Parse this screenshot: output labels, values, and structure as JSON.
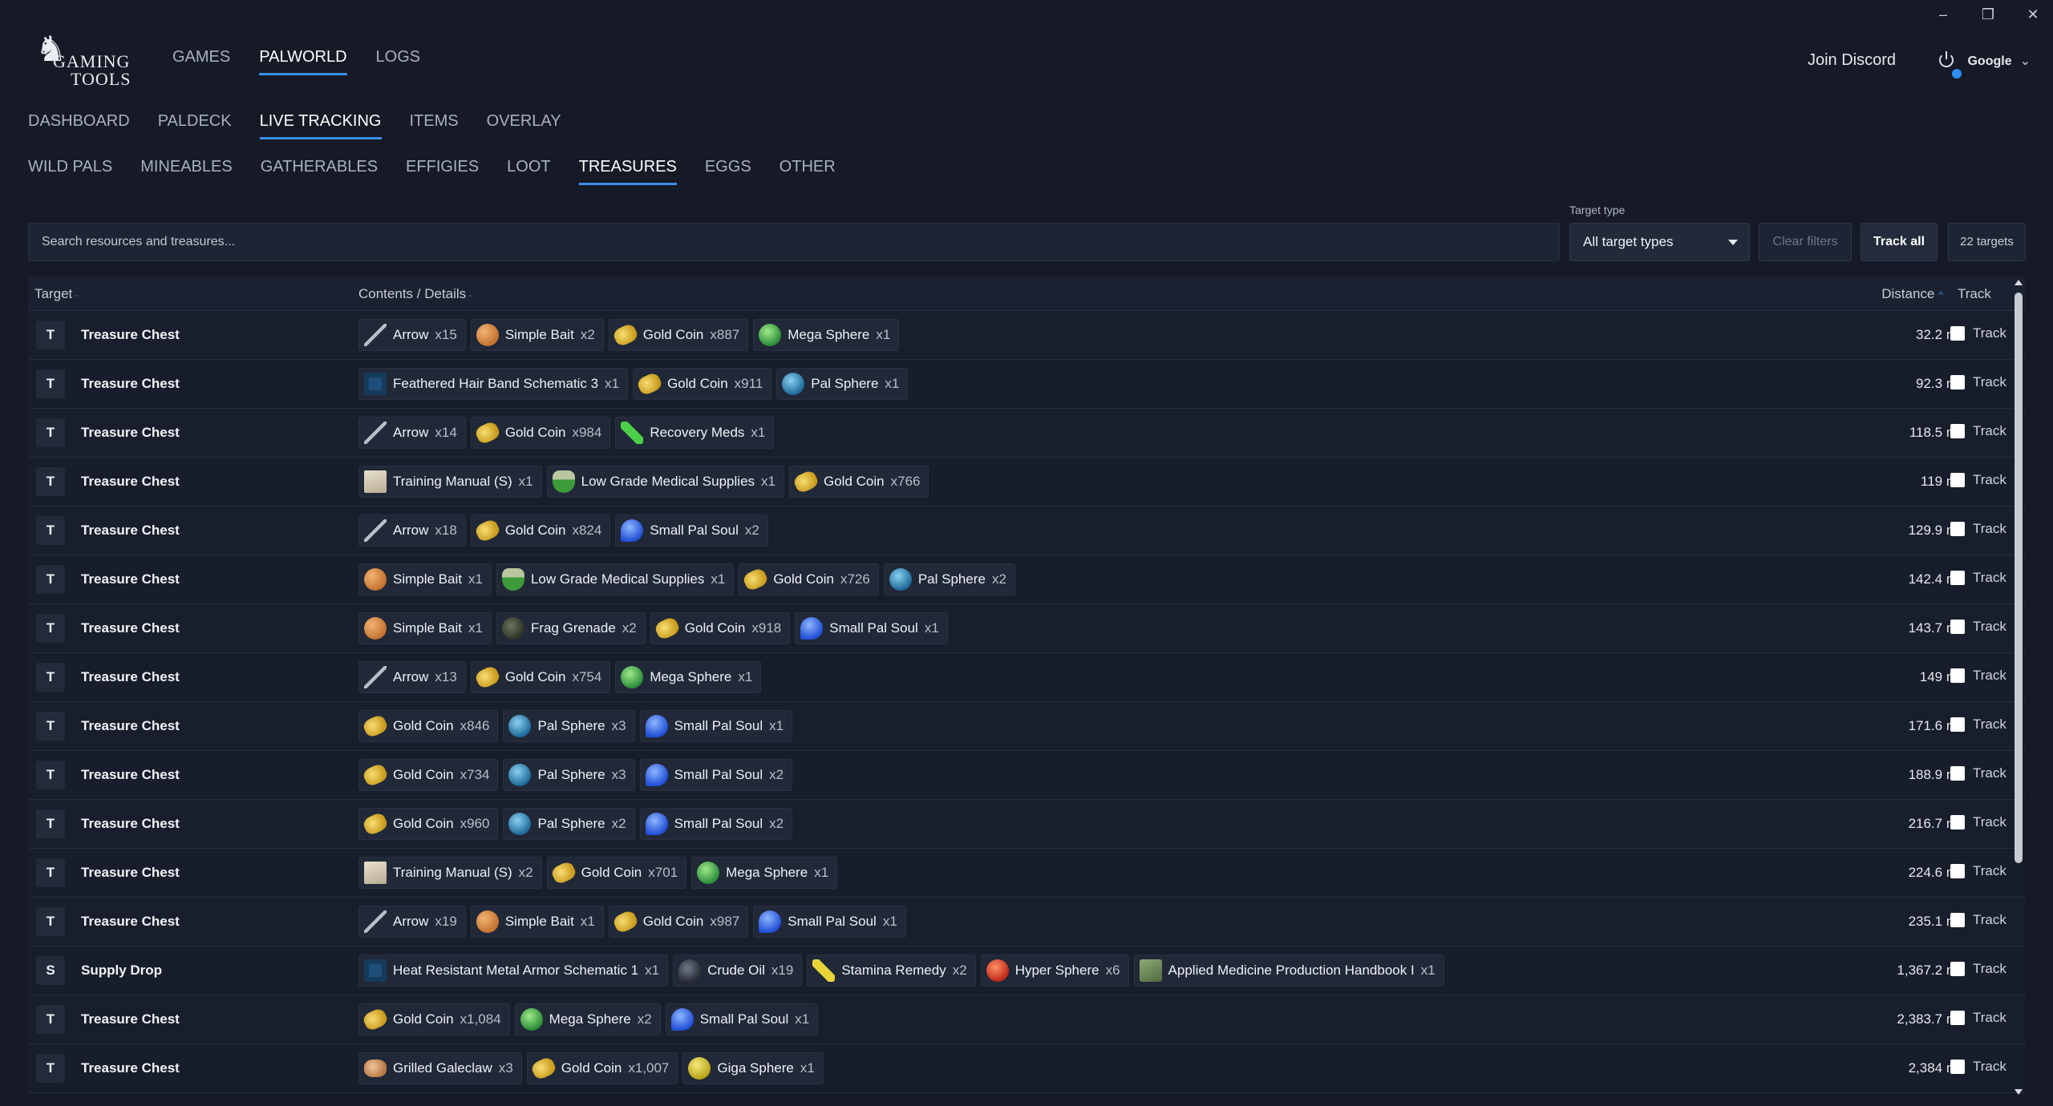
{
  "window": {
    "minimize": "–",
    "restore": "❐",
    "close": "✕"
  },
  "logo": {
    "line1": "GAMING",
    "line2": "TOOLS"
  },
  "top_nav": [
    {
      "label": "GAMES",
      "active": false
    },
    {
      "label": "PALWORLD",
      "active": true
    },
    {
      "label": "LOGS",
      "active": false
    }
  ],
  "header": {
    "discord": "Join Discord",
    "account": "Google"
  },
  "section_tabs": [
    {
      "label": "DASHBOARD",
      "active": false
    },
    {
      "label": "PALDECK",
      "active": false
    },
    {
      "label": "LIVE TRACKING",
      "active": true
    },
    {
      "label": "ITEMS",
      "active": false
    },
    {
      "label": "OVERLAY",
      "active": false
    }
  ],
  "category_tabs": [
    {
      "label": "WILD PALS",
      "active": false
    },
    {
      "label": "MINEABLES",
      "active": false
    },
    {
      "label": "GATHERABLES",
      "active": false
    },
    {
      "label": "EFFIGIES",
      "active": false
    },
    {
      "label": "LOOT",
      "active": false
    },
    {
      "label": "TREASURES",
      "active": true
    },
    {
      "label": "EGGS",
      "active": false
    },
    {
      "label": "OTHER",
      "active": false
    }
  ],
  "filters": {
    "search_placeholder": "Search resources and treasures...",
    "target_type_label": "Target type",
    "target_type_value": "All target types",
    "clear_label": "Clear filters",
    "track_all_label": "Track all",
    "count_label": "22 targets"
  },
  "table": {
    "headers": {
      "target": "Target",
      "contents": "Contents / Details",
      "distance": "Distance",
      "track": "Track"
    },
    "track_label": "Track",
    "rows": [
      {
        "badge": "T",
        "name": "Treasure Chest",
        "distance": "32.2 m",
        "items": [
          [
            "arrow",
            "Arrow",
            "x15"
          ],
          [
            "bait",
            "Simple Bait",
            "x2"
          ],
          [
            "coin",
            "Gold Coin",
            "x887"
          ],
          [
            "mega",
            "Mega Sphere",
            "x1"
          ]
        ]
      },
      {
        "badge": "T",
        "name": "Treasure Chest",
        "distance": "92.3 m",
        "items": [
          [
            "schem",
            "Feathered Hair Band Schematic 3",
            "x1"
          ],
          [
            "coin",
            "Gold Coin",
            "x911"
          ],
          [
            "pal",
            "Pal Sphere",
            "x1"
          ]
        ]
      },
      {
        "badge": "T",
        "name": "Treasure Chest",
        "distance": "118.5 m",
        "items": [
          [
            "arrow",
            "Arrow",
            "x14"
          ],
          [
            "coin",
            "Gold Coin",
            "x984"
          ],
          [
            "meds",
            "Recovery Meds",
            "x1"
          ]
        ]
      },
      {
        "badge": "T",
        "name": "Treasure Chest",
        "distance": "119 m",
        "items": [
          [
            "manual",
            "Training Manual (S)",
            "x1"
          ],
          [
            "supplies",
            "Low Grade Medical Supplies",
            "x1"
          ],
          [
            "coin",
            "Gold Coin",
            "x766"
          ]
        ]
      },
      {
        "badge": "T",
        "name": "Treasure Chest",
        "distance": "129.9 m",
        "items": [
          [
            "arrow",
            "Arrow",
            "x18"
          ],
          [
            "coin",
            "Gold Coin",
            "x824"
          ],
          [
            "soul",
            "Small Pal Soul",
            "x2"
          ]
        ]
      },
      {
        "badge": "T",
        "name": "Treasure Chest",
        "distance": "142.4 m",
        "items": [
          [
            "bait",
            "Simple Bait",
            "x1"
          ],
          [
            "supplies",
            "Low Grade Medical Supplies",
            "x1"
          ],
          [
            "coin",
            "Gold Coin",
            "x726"
          ],
          [
            "pal",
            "Pal Sphere",
            "x2"
          ]
        ]
      },
      {
        "badge": "T",
        "name": "Treasure Chest",
        "distance": "143.7 m",
        "items": [
          [
            "bait",
            "Simple Bait",
            "x1"
          ],
          [
            "grenade",
            "Frag Grenade",
            "x2"
          ],
          [
            "coin",
            "Gold Coin",
            "x918"
          ],
          [
            "soul",
            "Small Pal Soul",
            "x1"
          ]
        ]
      },
      {
        "badge": "T",
        "name": "Treasure Chest",
        "distance": "149 m",
        "items": [
          [
            "arrow",
            "Arrow",
            "x13"
          ],
          [
            "coin",
            "Gold Coin",
            "x754"
          ],
          [
            "mega",
            "Mega Sphere",
            "x1"
          ]
        ]
      },
      {
        "badge": "T",
        "name": "Treasure Chest",
        "distance": "171.6 m",
        "items": [
          [
            "coin",
            "Gold Coin",
            "x846"
          ],
          [
            "pal",
            "Pal Sphere",
            "x3"
          ],
          [
            "soul",
            "Small Pal Soul",
            "x1"
          ]
        ]
      },
      {
        "badge": "T",
        "name": "Treasure Chest",
        "distance": "188.9 m",
        "items": [
          [
            "coin",
            "Gold Coin",
            "x734"
          ],
          [
            "pal",
            "Pal Sphere",
            "x3"
          ],
          [
            "soul",
            "Small Pal Soul",
            "x2"
          ]
        ]
      },
      {
        "badge": "T",
        "name": "Treasure Chest",
        "distance": "216.7 m",
        "items": [
          [
            "coin",
            "Gold Coin",
            "x960"
          ],
          [
            "pal",
            "Pal Sphere",
            "x2"
          ],
          [
            "soul",
            "Small Pal Soul",
            "x2"
          ]
        ]
      },
      {
        "badge": "T",
        "name": "Treasure Chest",
        "distance": "224.6 m",
        "items": [
          [
            "manual",
            "Training Manual (S)",
            "x2"
          ],
          [
            "coin",
            "Gold Coin",
            "x701"
          ],
          [
            "mega",
            "Mega Sphere",
            "x1"
          ]
        ]
      },
      {
        "badge": "T",
        "name": "Treasure Chest",
        "distance": "235.1 m",
        "items": [
          [
            "arrow",
            "Arrow",
            "x19"
          ],
          [
            "bait",
            "Simple Bait",
            "x1"
          ],
          [
            "coin",
            "Gold Coin",
            "x987"
          ],
          [
            "soul",
            "Small Pal Soul",
            "x1"
          ]
        ]
      },
      {
        "badge": "S",
        "name": "Supply Drop",
        "distance": "1,367.2 m",
        "items": [
          [
            "schem",
            "Heat Resistant Metal Armor Schematic 1",
            "x1"
          ],
          [
            "oil",
            "Crude Oil",
            "x19"
          ],
          [
            "stamina",
            "Stamina Remedy",
            "x2"
          ],
          [
            "hyper",
            "Hyper Sphere",
            "x6"
          ],
          [
            "handbook",
            "Applied Medicine Production Handbook I",
            "x1"
          ]
        ]
      },
      {
        "badge": "T",
        "name": "Treasure Chest",
        "distance": "2,383.7 m",
        "items": [
          [
            "coin",
            "Gold Coin",
            "x1,084"
          ],
          [
            "mega",
            "Mega Sphere",
            "x2"
          ],
          [
            "soul",
            "Small Pal Soul",
            "x1"
          ]
        ]
      },
      {
        "badge": "T",
        "name": "Treasure Chest",
        "distance": "2,384 m",
        "items": [
          [
            "galeclaw",
            "Grilled Galeclaw",
            "x3"
          ],
          [
            "coin",
            "Gold Coin",
            "x1,007"
          ],
          [
            "giga",
            "Giga Sphere",
            "x1"
          ]
        ]
      }
    ]
  },
  "colors": {
    "background": "#151a26",
    "accent": "#3a8ee6"
  }
}
